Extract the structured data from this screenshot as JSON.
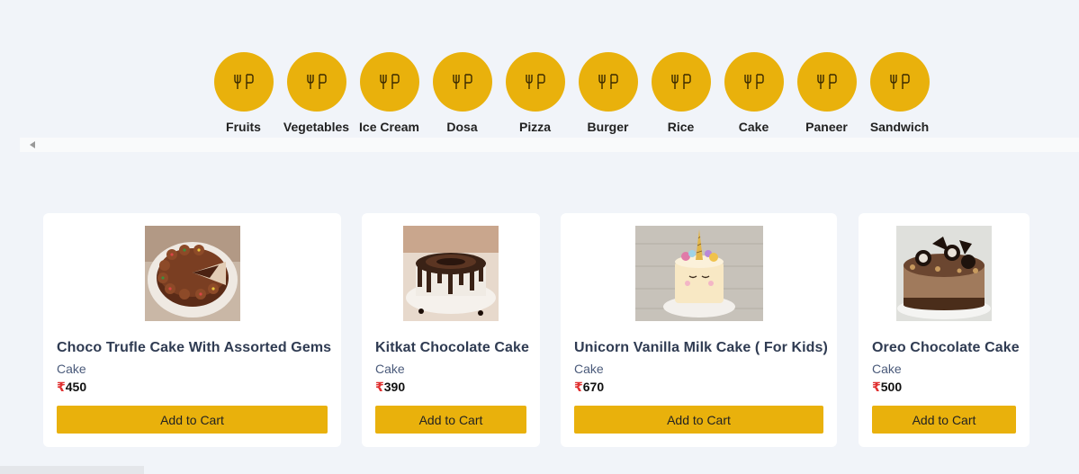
{
  "categories": [
    {
      "label": "Fruits",
      "icon": "fork-knife-icon"
    },
    {
      "label": "Vegetables",
      "icon": "fork-knife-icon"
    },
    {
      "label": "Ice Cream",
      "icon": "fork-knife-icon"
    },
    {
      "label": "Dosa",
      "icon": "fork-knife-icon"
    },
    {
      "label": "Pizza",
      "icon": "fork-knife-icon"
    },
    {
      "label": "Burger",
      "icon": "fork-knife-icon"
    },
    {
      "label": "Rice",
      "icon": "fork-knife-icon"
    },
    {
      "label": "Cake",
      "icon": "fork-knife-icon"
    },
    {
      "label": "Paneer",
      "icon": "fork-knife-icon"
    },
    {
      "label": "Sandwich",
      "icon": "fork-knife-icon"
    }
  ],
  "products": [
    {
      "title": "Choco Trufle Cake With Assorted Gems",
      "category": "Cake",
      "currency": "₹",
      "price": "450",
      "button": "Add to Cart",
      "image": "choco-truffle-cake"
    },
    {
      "title": "Kitkat Chocolate Cake",
      "category": "Cake",
      "currency": "₹",
      "price": "390",
      "button": "Add to Cart",
      "image": "kitkat-chocolate-cake"
    },
    {
      "title": "Unicorn Vanilla Milk Cake ( For Kids)",
      "category": "Cake",
      "currency": "₹",
      "price": "670",
      "button": "Add to Cart",
      "image": "unicorn-vanilla-cake"
    },
    {
      "title": "Oreo Chocolate Cake",
      "category": "Cake",
      "currency": "₹",
      "price": "500",
      "button": "Add to Cart",
      "image": "oreo-chocolate-cake"
    }
  ],
  "colors": {
    "accent": "#e9b10c",
    "background": "#f1f4f9",
    "price_symbol": "#e03131"
  }
}
